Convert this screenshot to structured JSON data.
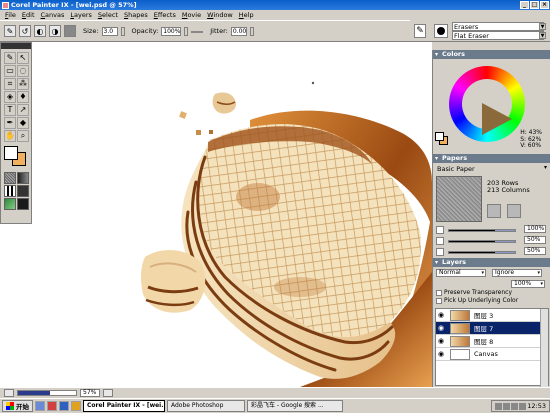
{
  "window": {
    "title": "Corel Painter IX - [wei.psd @ 57%]"
  },
  "menu": [
    "File",
    "Edit",
    "Canvas",
    "Layers",
    "Select",
    "Shapes",
    "Effects",
    "Movie",
    "Window",
    "Help"
  ],
  "property_bar": {
    "size_label": "Size:",
    "size_value": "3.0",
    "opacity_label": "Opacity:",
    "opacity_value": "100%",
    "jitter_label": "Jitter:",
    "jitter_value": "0.00"
  },
  "brush": {
    "category": "Erasers",
    "variant": "Flat Eraser"
  },
  "colors": {
    "title": "Colors",
    "h": "H: 43%",
    "s": "S: 62%",
    "v": "V: 60%",
    "primary": "#ffffff",
    "secondary": "#f0b060"
  },
  "papers": {
    "title": "Papers",
    "name": "Basic Paper",
    "rows": "203 Rows",
    "columns": "213 Columns",
    "sliders": [
      "100%",
      "50%",
      "50%"
    ]
  },
  "layers": {
    "title": "Layers",
    "composite": "Normal",
    "depth": "Ignore",
    "opacity": "100%",
    "preserve_transparency": "Preserve Transparency",
    "pick_up_underlying": "Pick Up Underlying Color",
    "items": [
      {
        "name": "图层 3",
        "selected": false
      },
      {
        "name": "图层 7",
        "selected": true
      },
      {
        "name": "图层 8",
        "selected": false
      },
      {
        "name": "Canvas",
        "selected": false
      }
    ]
  },
  "navigator": {
    "zoom": "57%"
  },
  "taskbar": {
    "start": "开始",
    "tasks": [
      "Corel Painter IX - [wei...",
      "Adobe Photoshop",
      "彩晶飞车 - Google 搜索 ..."
    ],
    "clock": "12:53"
  }
}
